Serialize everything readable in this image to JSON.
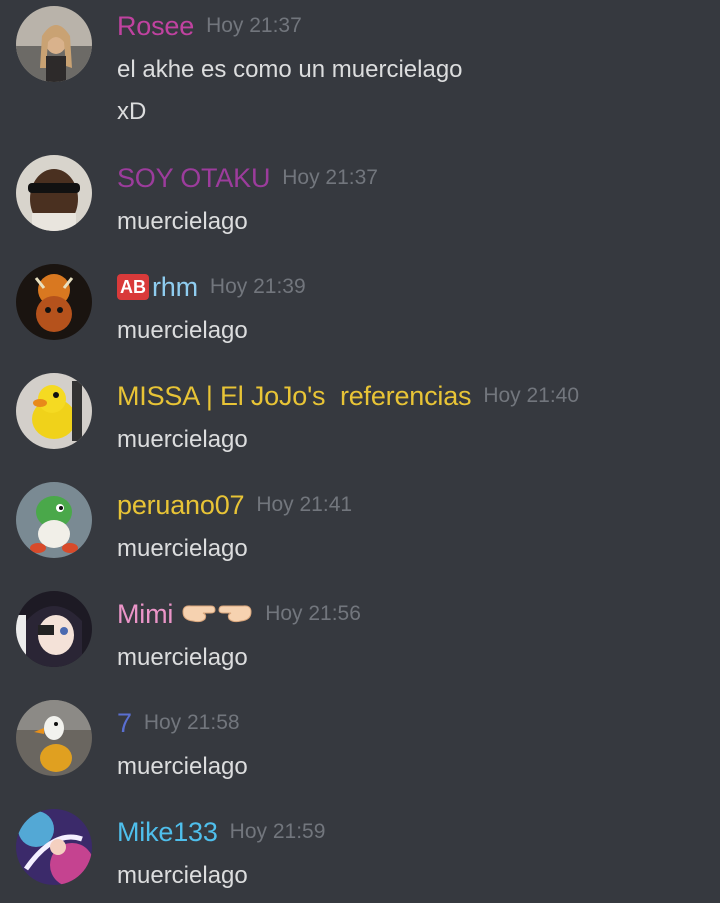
{
  "messages": [
    {
      "username": "Rosee",
      "time": "Hoy 21:37",
      "color": "#c042a0",
      "lines": [
        "el akhe es como un muercielago",
        "xD"
      ]
    },
    {
      "username": "SOY OTAKU",
      "time": "Hoy 21:37",
      "color": "#9c3c9c",
      "lines": [
        "muercielago"
      ]
    },
    {
      "badge": "AB",
      "username": "rhm",
      "time": "Hoy 21:39",
      "color": "#8fcdf0",
      "lines": [
        "muercielago"
      ]
    },
    {
      "username": "MISSA | El JoJo's  referencias",
      "time": "Hoy 21:40",
      "color": "#e8c436",
      "lines": [
        "muercielago"
      ]
    },
    {
      "username": "peruano07",
      "time": "Hoy 21:41",
      "color": "#e8c436",
      "lines": [
        "muercielago"
      ]
    },
    {
      "username": "Mimi",
      "time": "Hoy 21:56",
      "color": "#eb95c8",
      "emoji": "pointing-fingers",
      "lines": [
        "muercielago"
      ]
    },
    {
      "username": "7",
      "time": "Hoy 21:58",
      "color": "#5a6fd1",
      "lines": [
        "muercielago"
      ]
    },
    {
      "username": "Mike133",
      "time": "Hoy 21:59",
      "color": "#4fbfec",
      "lines": [
        "muercielago"
      ]
    }
  ]
}
